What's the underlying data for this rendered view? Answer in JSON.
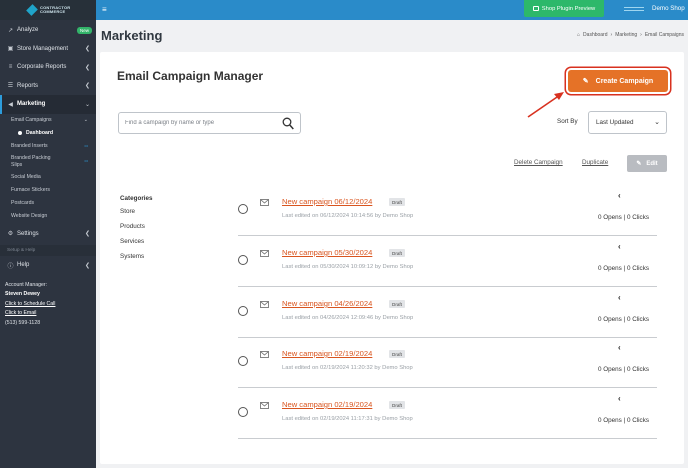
{
  "brand": {
    "line1": "CONTRACTOR",
    "line2": "COMMERCE"
  },
  "sidebar": {
    "items": [
      {
        "label": "Analyze",
        "icon": "chart-icon",
        "badge": "New"
      },
      {
        "label": "Store Management",
        "icon": "store-icon"
      },
      {
        "label": "Corporate Reports",
        "icon": "layers-icon"
      },
      {
        "label": "Reports",
        "icon": "bar-chart-icon"
      },
      {
        "label": "Marketing",
        "icon": "megaphone-icon"
      }
    ],
    "marketing_sub": [
      {
        "label": "Email Campaigns"
      },
      {
        "label": "Dashboard"
      },
      {
        "label": "Branded Inserts"
      },
      {
        "label": "Branded Packing Slips"
      },
      {
        "label": "Social Media"
      },
      {
        "label": "Furnace Stickers"
      },
      {
        "label": "Postcards"
      },
      {
        "label": "Website Design"
      }
    ],
    "settings": "Settings",
    "setup": "Setup & Help",
    "help": "Help",
    "account": {
      "title": "Account Manager:",
      "name": "Steven Dewey",
      "schedule": "Click to Schedule Call",
      "email": "Click to Email",
      "phone": "(513) 599-1128"
    }
  },
  "topbar": {
    "plugin_button": "Shop Plugin Preview",
    "shop_name": "Demo Shop"
  },
  "page": {
    "title": "Marketing",
    "breadcrumb": [
      "Dashboard",
      "Marketing",
      "Email Campaigns"
    ]
  },
  "manager": {
    "title": "Email Campaign Manager",
    "create_button": "Create Campaign",
    "search_placeholder": "Find a campaign by name or type",
    "sort_label": "Sort By",
    "sort_value": "Last Updated",
    "delete_link": "Delete Campaign",
    "duplicate_link": "Duplicate",
    "edit_button": "Edit"
  },
  "categories": {
    "heading": "Categories",
    "items": [
      "Store",
      "Products",
      "Services",
      "Systems"
    ]
  },
  "campaigns": [
    {
      "name": "New campaign 06/12/2024",
      "status": "Draft",
      "edited": "Last edited on 06/12/2024 10:14:56 by Demo Shop",
      "stats": "0 Opens | 0 Clicks"
    },
    {
      "name": "New campaign 05/30/2024",
      "status": "Draft",
      "edited": "Last edited on 05/30/2024 10:09:12 by Demo Shop",
      "stats": "0 Opens | 0 Clicks"
    },
    {
      "name": "New campaign 04/26/2024",
      "status": "Draft",
      "edited": "Last edited on 04/26/2024 12:09:46 by Demo Shop",
      "stats": "0 Opens | 0 Clicks"
    },
    {
      "name": "New campaign 02/19/2024",
      "status": "Draft",
      "edited": "Last edited on 02/19/2024 11:20:32 by Demo Shop",
      "stats": "0 Opens | 0 Clicks"
    },
    {
      "name": "New campaign 02/19/2024",
      "status": "Draft",
      "edited": "Last edited on 02/19/2024 11:17:31 by Demo Shop",
      "stats": "0 Opens | 0 Clicks"
    }
  ],
  "colors": {
    "accent": "#e57227",
    "topbar": "#2a8bc9",
    "sidebar": "#2d3440",
    "plugin": "#2db86a",
    "highlight": "#d8311f"
  }
}
